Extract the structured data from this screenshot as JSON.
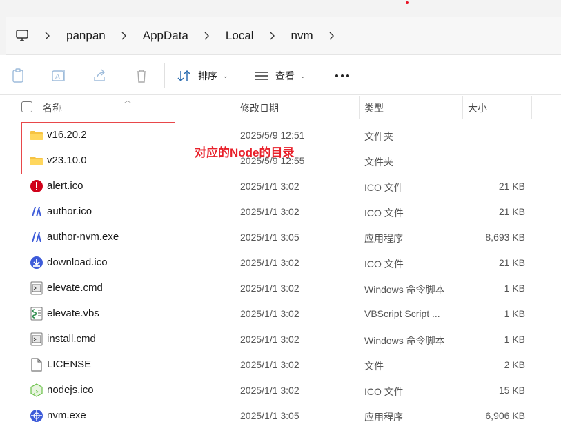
{
  "breadcrumb": {
    "items": [
      "panpan",
      "AppData",
      "Local",
      "nvm"
    ]
  },
  "toolbar": {
    "sort_label": "排序",
    "view_label": "查看"
  },
  "columns": {
    "name": "名称",
    "date": "修改日期",
    "type": "类型",
    "size": "大小"
  },
  "files": [
    {
      "name": "v16.20.2",
      "date": "2025/5/9 12:51",
      "type": "文件夹",
      "size": "",
      "icon": "folder-icon"
    },
    {
      "name": "v23.10.0",
      "date": "2025/5/9 12:55",
      "type": "文件夹",
      "size": "",
      "icon": "folder-icon"
    },
    {
      "name": "alert.ico",
      "date": "2025/1/1 3:02",
      "type": "ICO 文件",
      "size": "21 KB",
      "icon": "alert-icon"
    },
    {
      "name": "author.ico",
      "date": "2025/1/1 3:02",
      "type": "ICO 文件",
      "size": "21 KB",
      "icon": "nvm-logo-icon"
    },
    {
      "name": "author-nvm.exe",
      "date": "2025/1/1 3:05",
      "type": "应用程序",
      "size": "8,693 KB",
      "icon": "nvm-logo-icon"
    },
    {
      "name": "download.ico",
      "date": "2025/1/1 3:02",
      "type": "ICO 文件",
      "size": "21 KB",
      "icon": "download-icon"
    },
    {
      "name": "elevate.cmd",
      "date": "2025/1/1 3:02",
      "type": "Windows 命令脚本",
      "size": "1 KB",
      "icon": "cmd-file-icon"
    },
    {
      "name": "elevate.vbs",
      "date": "2025/1/1 3:02",
      "type": "VBScript Script ...",
      "size": "1 KB",
      "icon": "vbs-file-icon"
    },
    {
      "name": "install.cmd",
      "date": "2025/1/1 3:02",
      "type": "Windows 命令脚本",
      "size": "1 KB",
      "icon": "cmd-file-icon"
    },
    {
      "name": "LICENSE",
      "date": "2025/1/1 3:02",
      "type": "文件",
      "size": "2 KB",
      "icon": "blank-file-icon"
    },
    {
      "name": "nodejs.ico",
      "date": "2025/1/1 3:02",
      "type": "ICO 文件",
      "size": "15 KB",
      "icon": "nodejs-icon"
    },
    {
      "name": "nvm.exe",
      "date": "2025/1/1 3:05",
      "type": "应用程序",
      "size": "6,906 KB",
      "icon": "nvm-app-icon"
    }
  ],
  "annotation": {
    "text": "对应的Node的目录",
    "color": "#e8202a"
  },
  "colors": {
    "folder": "#f6c343",
    "alert": "#d0021b",
    "accent": "#3d5bd9"
  }
}
